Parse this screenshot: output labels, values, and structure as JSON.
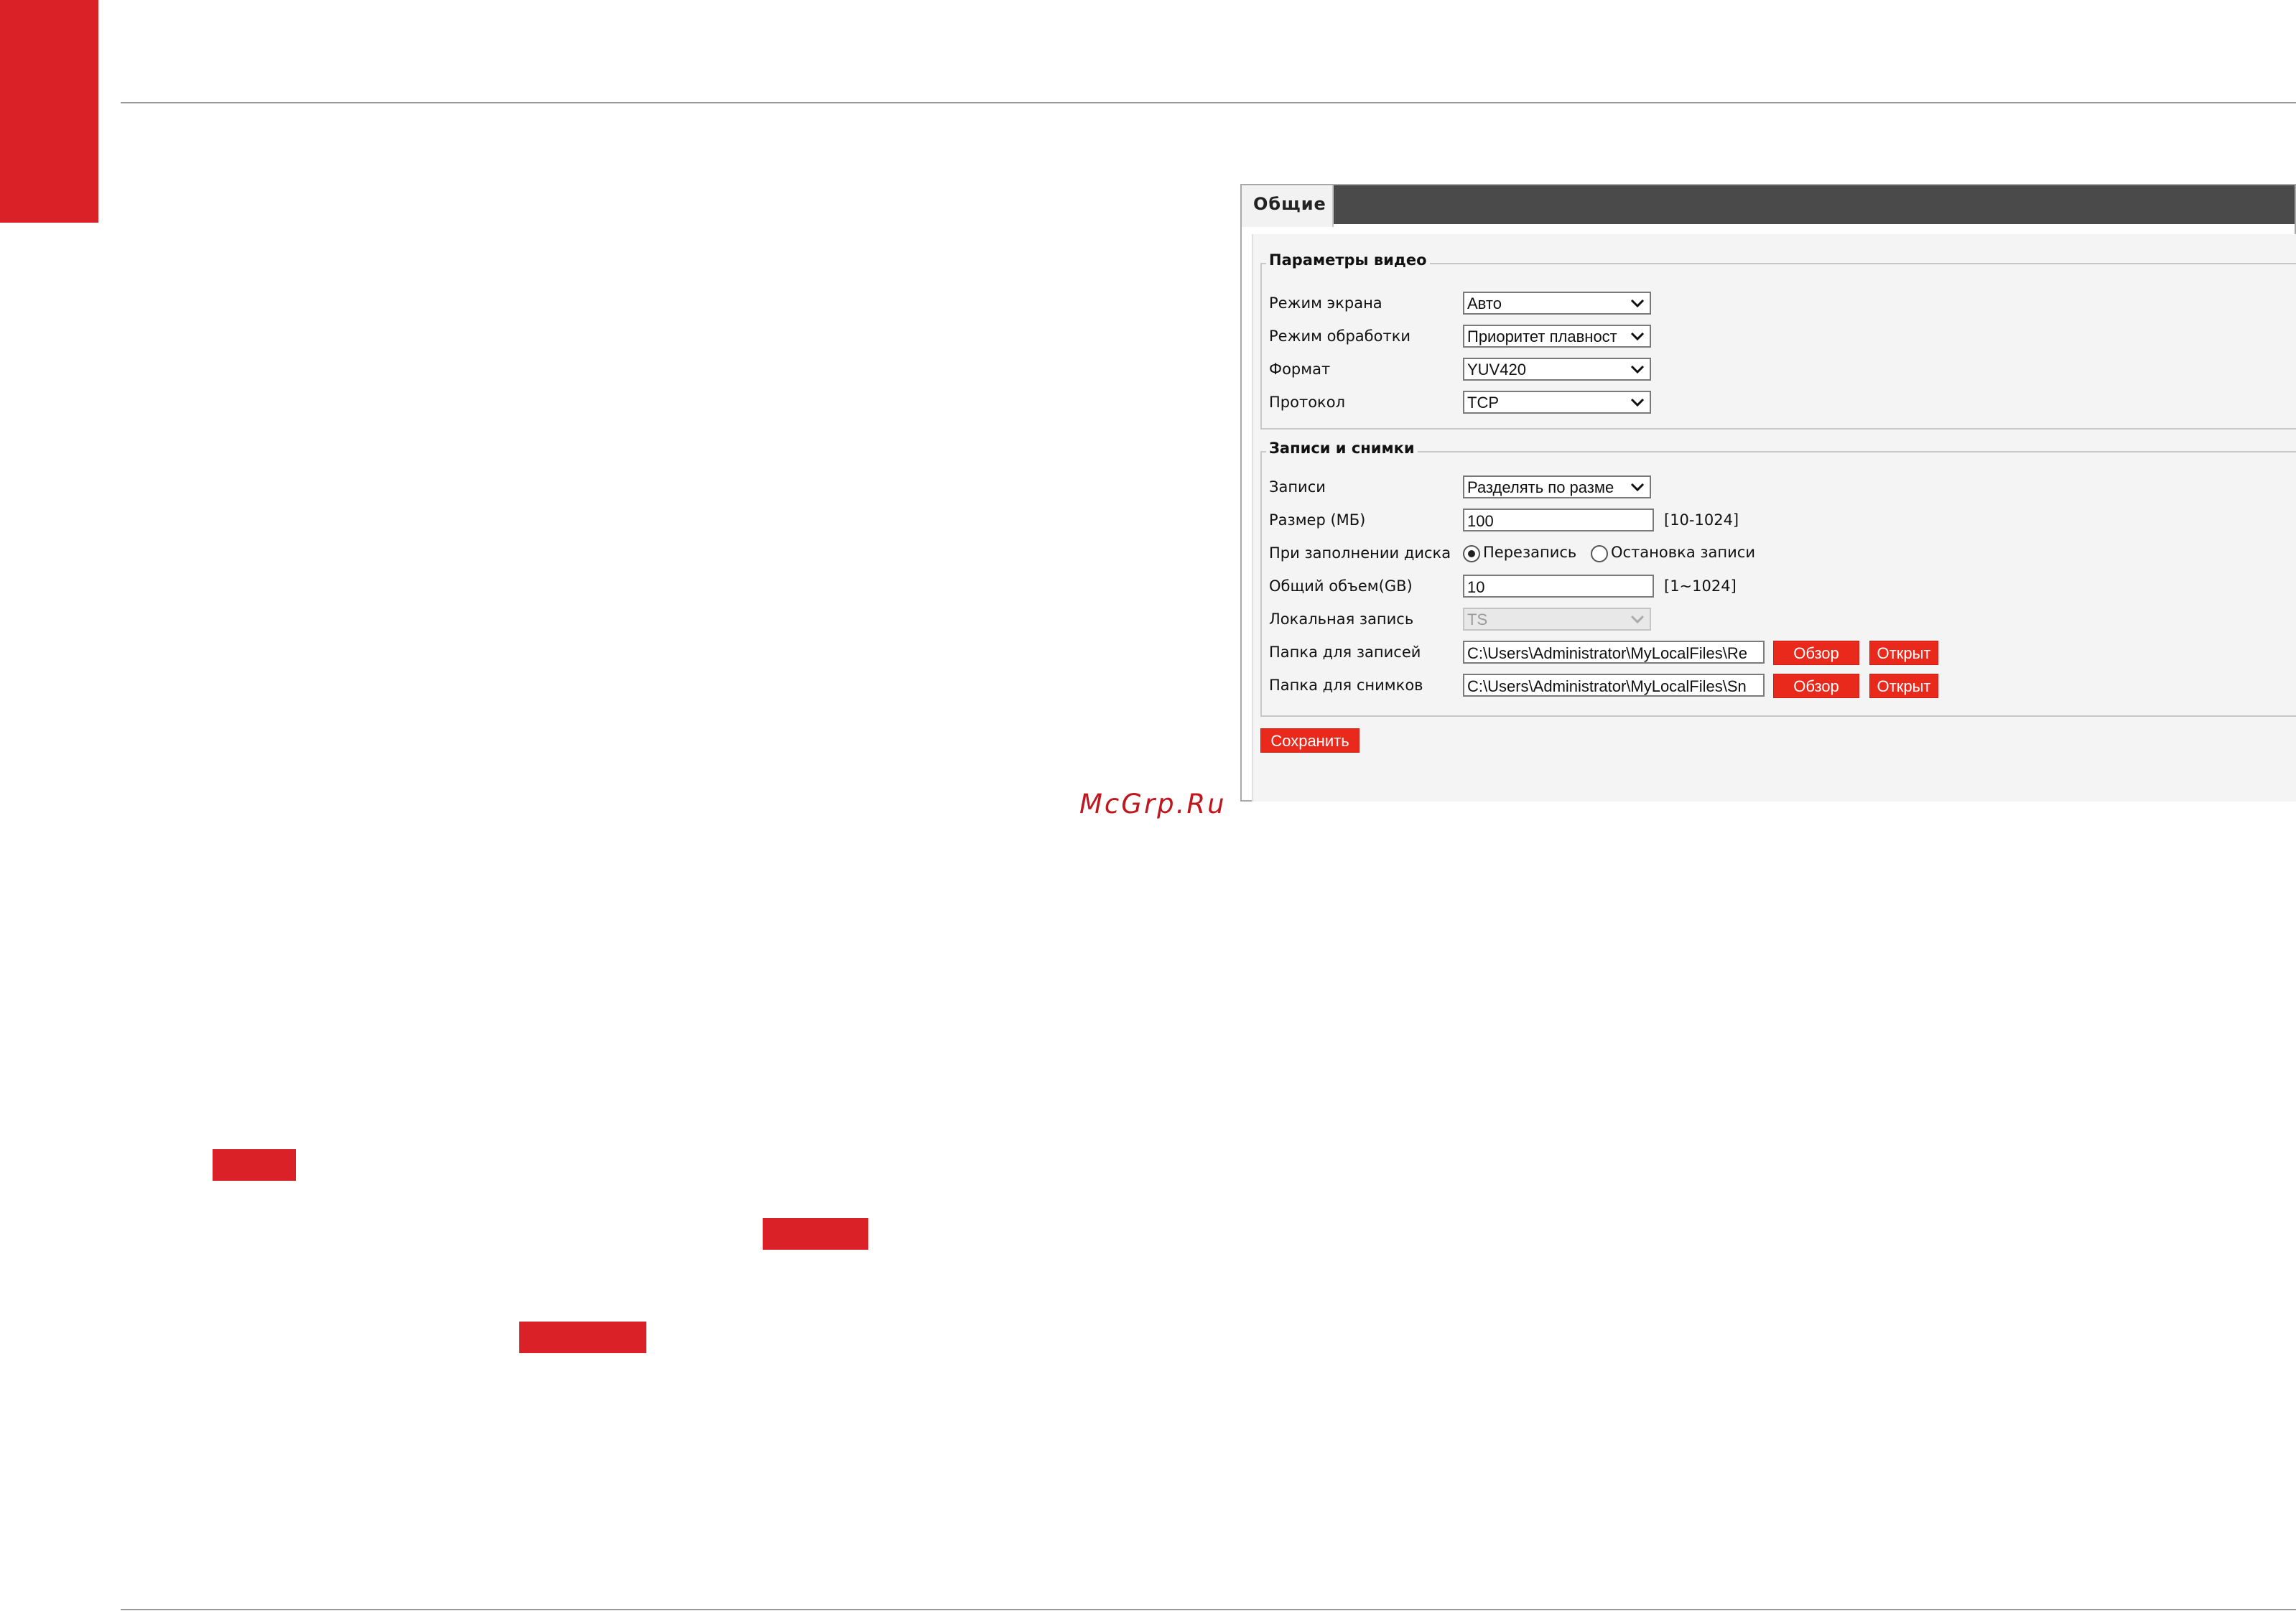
{
  "watermark": "McGrp.Ru",
  "settings": {
    "tab": "Общие",
    "video": {
      "legend": "Параметры видео",
      "rows": [
        {
          "label": "Режим экрана",
          "value": "Авто"
        },
        {
          "label": "Режим обработки",
          "value": "Приоритет плавност"
        },
        {
          "label": "Формат",
          "value": "YUV420"
        },
        {
          "label": "Протокол",
          "value": "TCP"
        }
      ]
    },
    "records": {
      "legend": "Записи и снимки",
      "records_label": "Записи",
      "records_value": "Разделять по разме",
      "size_label": "Размер (МБ)",
      "size_value": "100",
      "size_hint": "[10-1024]",
      "disk_full_label": "При заполнении диска",
      "overwrite_label": "Перезапись",
      "stop_label": "Остановка записи",
      "overwrite_selected": true,
      "total_label": "Общий объем(GB)",
      "total_value": "10",
      "total_hint": "[1~1024]",
      "local_label": "Локальная запись",
      "local_value": "TS",
      "rec_folder_label": "Папка для записей",
      "rec_folder_value": "C:\\Users\\Administrator\\MyLocalFiles\\Re",
      "snap_folder_label": "Папка для снимков",
      "snap_folder_value": "C:\\Users\\Administrator\\MyLocalFiles\\Sn",
      "browse_label": "Обзор",
      "open_label": "Открыт"
    },
    "save_label": "Сохранить"
  },
  "colors": {
    "brand_red": "#da2128",
    "button_red": "#e8291c",
    "tabbar": "#4a4a4a"
  }
}
